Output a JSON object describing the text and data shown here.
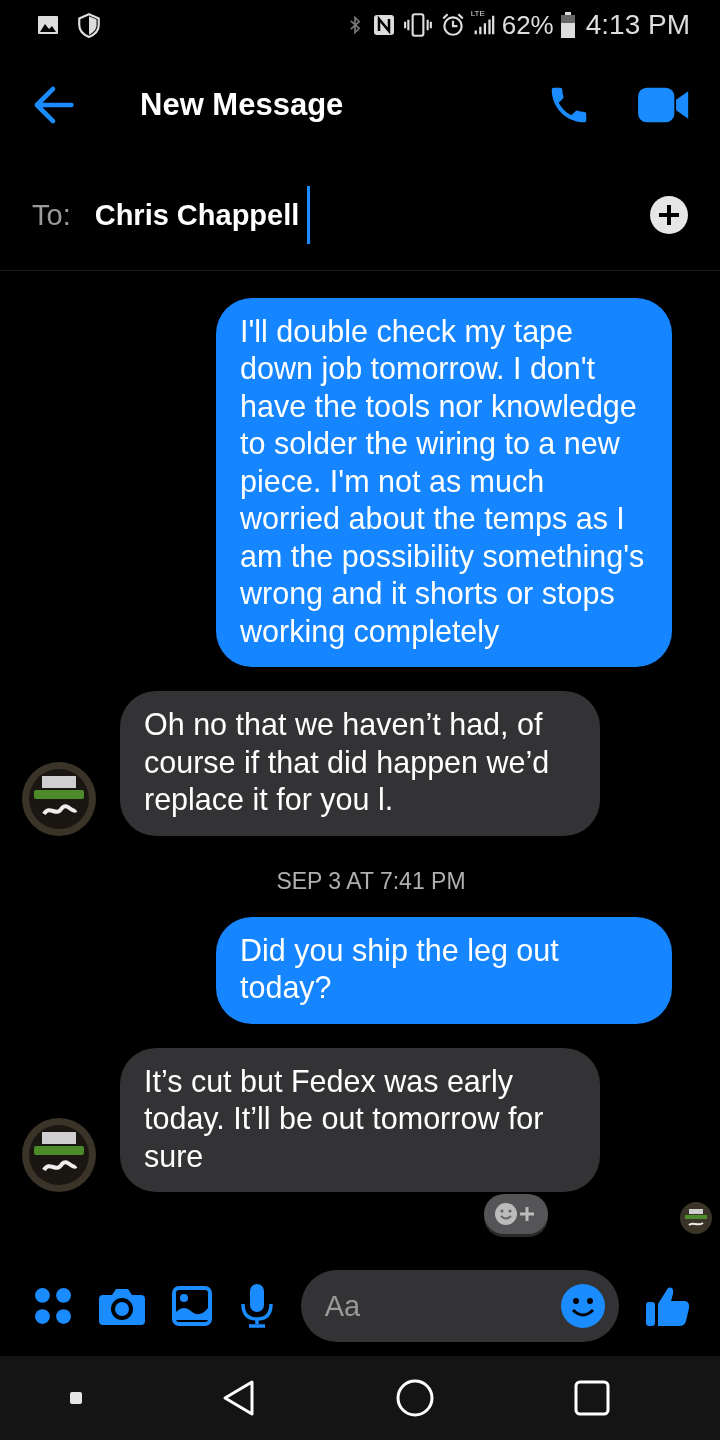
{
  "status_bar": {
    "network": "LTE",
    "battery": "62%",
    "time": "4:13 PM"
  },
  "header": {
    "title": "New Message"
  },
  "recipient": {
    "label": "To:",
    "value": "Chris Chappell"
  },
  "messages": [
    {
      "kind": "outgoing",
      "text": "I'll double check my tape down job tomorrow. I don't have the tools nor knowledge to solder the wiring to a new piece. I'm not as much worried about the temps as I am the possibility something's wrong and it shorts or stops working completely"
    },
    {
      "kind": "incoming",
      "text": "Oh no that we haven’t had, of course if that did happen we’d replace it for you l."
    },
    {
      "kind": "timestamp",
      "text": "SEP 3 AT 7:41 PM"
    },
    {
      "kind": "outgoing",
      "text": "Did you ship the leg out today?"
    },
    {
      "kind": "incoming",
      "text": "It’s cut but Fedex was early today.  It’ll be out tomorrow for sure"
    }
  ],
  "composer": {
    "placeholder": "Aa"
  }
}
